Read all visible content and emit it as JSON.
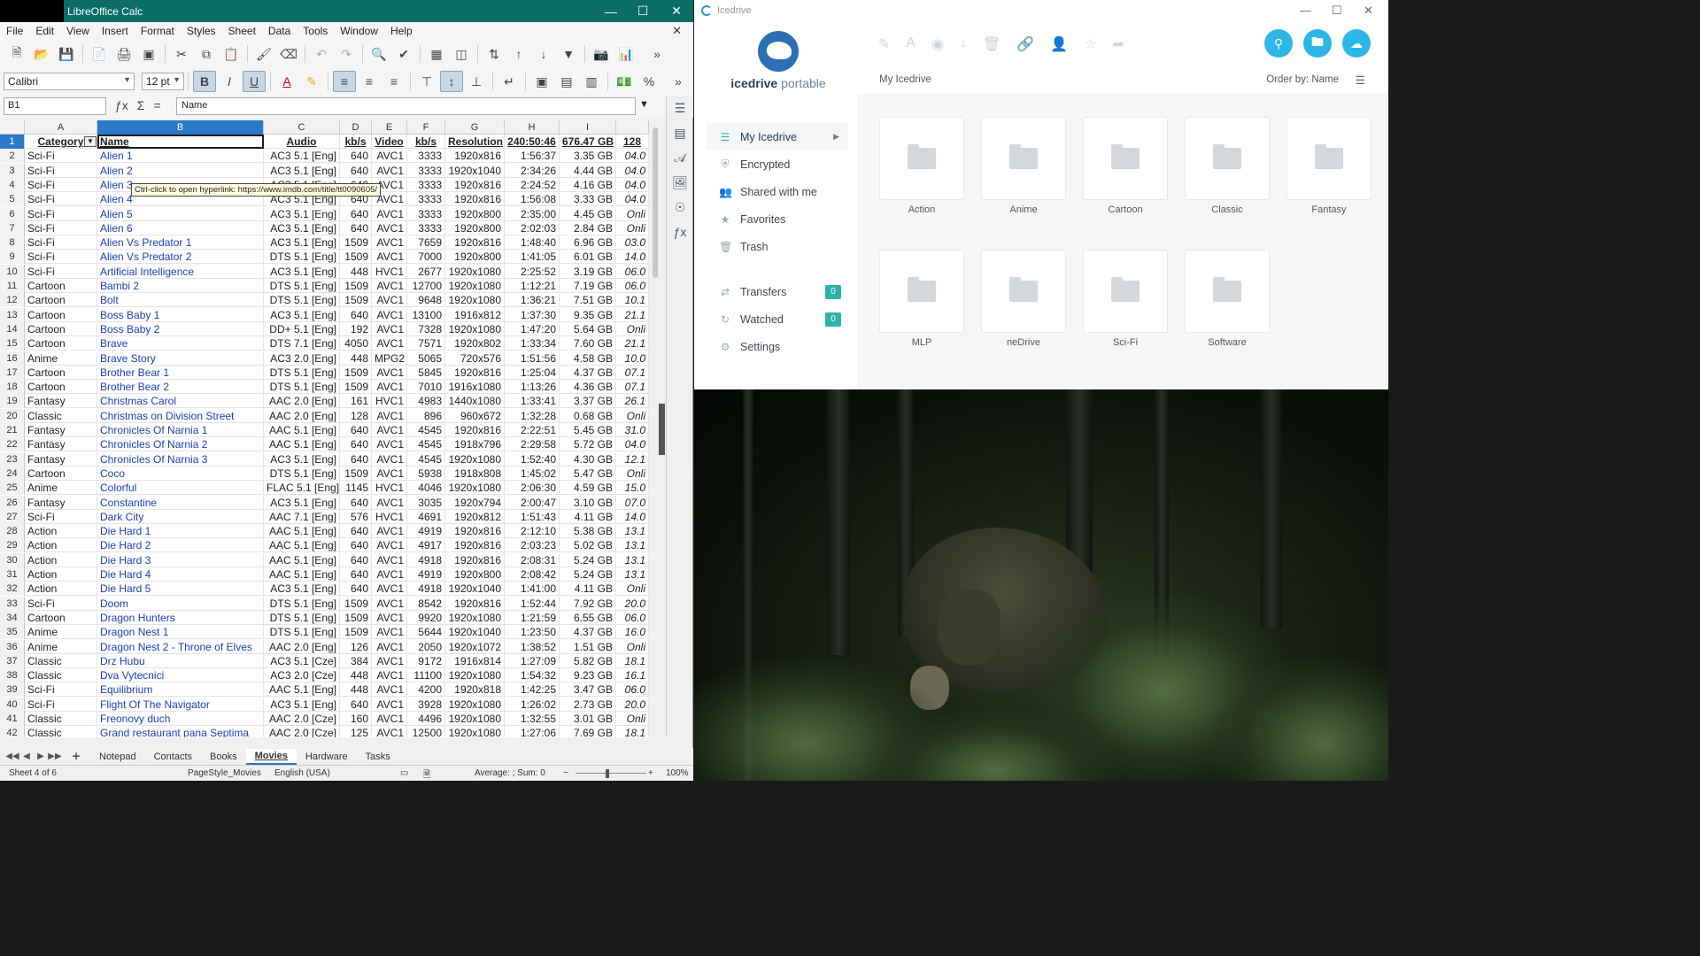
{
  "calc": {
    "title": "LibreOffice Calc",
    "menu": [
      "File",
      "Edit",
      "View",
      "Insert",
      "Format",
      "Styles",
      "Sheet",
      "Data",
      "Tools",
      "Window",
      "Help"
    ],
    "font_name": "Calibri",
    "font_size": "12 pt",
    "name_box": "B1",
    "formula": "Name",
    "columns": [
      "A",
      "B",
      "C",
      "D",
      "E",
      "F",
      "G",
      "H",
      "I"
    ],
    "header": [
      "Category",
      "Name",
      "Audio",
      "kb/s",
      "Video",
      "kb/s",
      "Resolution",
      "240:50:46",
      "676.47 GB",
      "128"
    ],
    "rows": [
      [
        "2",
        "Sci-Fi",
        "Alien 1",
        "AC3 5.1 [Eng]",
        "640",
        "AVC1",
        "3333",
        "1920x816",
        "1:56:37",
        "3.35 GB",
        "04.0"
      ],
      [
        "3",
        "Sci-Fi",
        "Alien 2",
        "AC3 5.1 [Eng]",
        "640",
        "AVC1",
        "3333",
        "1920x1040",
        "2:34:26",
        "4.44 GB",
        "04.0"
      ],
      [
        "4",
        "Sci-Fi",
        "Alien 3",
        "AC3 5.1 [Eng]",
        "640",
        "AVC1",
        "3333",
        "1920x816",
        "2:24:52",
        "4.16 GB",
        "04.0"
      ],
      [
        "5",
        "Sci-Fi",
        "Alien 4",
        "AC3 5.1 [Eng]",
        "640",
        "AVC1",
        "3333",
        "1920x816",
        "1:56:08",
        "3.33 GB",
        "04.0"
      ],
      [
        "6",
        "Sci-Fi",
        "Alien 5",
        "AC3 5.1 [Eng]",
        "640",
        "AVC1",
        "3333",
        "1920x800",
        "2:35:00",
        "4.45 GB",
        "Onli"
      ],
      [
        "7",
        "Sci-Fi",
        "Alien 6",
        "AC3 5.1 [Eng]",
        "640",
        "AVC1",
        "3333",
        "1920x800",
        "2:02:03",
        "2.84 GB",
        "Onli"
      ],
      [
        "8",
        "Sci-Fi",
        "Alien Vs Predator 1",
        "AC3 5.1 [Eng]",
        "1509",
        "AVC1",
        "7659",
        "1920x816",
        "1:48:40",
        "6.96 GB",
        "03.0"
      ],
      [
        "9",
        "Sci-Fi",
        "Alien Vs Predator 2",
        "DTS 5.1 [Eng]",
        "1509",
        "AVC1",
        "7000",
        "1920x800",
        "1:41:05",
        "6.01 GB",
        "14.0"
      ],
      [
        "10",
        "Sci-Fi",
        "Artificial Intelligence",
        "AC3 5.1 [Eng]",
        "448",
        "HVC1",
        "2677",
        "1920x1080",
        "2:25:52",
        "3.19 GB",
        "06.0"
      ],
      [
        "11",
        "Cartoon",
        "Bambi 2",
        "DTS 5.1 [Eng]",
        "1509",
        "AVC1",
        "12700",
        "1920x1080",
        "1:12:21",
        "7.19 GB",
        "06.0"
      ],
      [
        "12",
        "Cartoon",
        "Bolt",
        "DTS 5.1 [Eng]",
        "1509",
        "AVC1",
        "9648",
        "1920x1080",
        "1:36:21",
        "7.51 GB",
        "10.1"
      ],
      [
        "13",
        "Cartoon",
        "Boss Baby 1",
        "AC3 5.1 [Eng]",
        "640",
        "AVC1",
        "13100",
        "1916x812",
        "1:37:30",
        "9.35 GB",
        "21.1"
      ],
      [
        "14",
        "Cartoon",
        "Boss Baby 2",
        "DD+ 5.1 [Eng]",
        "192",
        "AVC1",
        "7328",
        "1920x1080",
        "1:47:20",
        "5.64 GB",
        "Onli"
      ],
      [
        "15",
        "Cartoon",
        "Brave",
        "DTS 7.1 [Eng]",
        "4050",
        "AVC1",
        "7571",
        "1920x802",
        "1:33:34",
        "7.60 GB",
        "21.1"
      ],
      [
        "16",
        "Anime",
        "Brave Story",
        "AC3 2.0 [Eng]",
        "448",
        "MPG2",
        "5065",
        "720x576",
        "1:51:56",
        "4.58 GB",
        "10.0"
      ],
      [
        "17",
        "Cartoon",
        "Brother Bear 1",
        "DTS 5.1 [Eng]",
        "1509",
        "AVC1",
        "5845",
        "1920x816",
        "1:25:04",
        "4.37 GB",
        "07.1"
      ],
      [
        "18",
        "Cartoon",
        "Brother Bear 2",
        "DTS 5.1 [Eng]",
        "1509",
        "AVC1",
        "7010",
        "1916x1080",
        "1:13:26",
        "4.36 GB",
        "07.1"
      ],
      [
        "19",
        "Fantasy",
        "Christmas Carol",
        "AAC 2.0 [Eng]",
        "161",
        "HVC1",
        "4983",
        "1440x1080",
        "1:33:41",
        "3.37 GB",
        "26.1"
      ],
      [
        "20",
        "Classic",
        "Christmas on Division Street",
        "AAC 2.0 [Eng]",
        "128",
        "AVC1",
        "896",
        "960x672",
        "1:32:28",
        "0.68 GB",
        "Onli"
      ],
      [
        "21",
        "Fantasy",
        "Chronicles Of Narnia 1",
        "AAC 5.1 [Eng]",
        "640",
        "AVC1",
        "4545",
        "1920x816",
        "2:22:51",
        "5.45 GB",
        "31.0"
      ],
      [
        "22",
        "Fantasy",
        "Chronicles Of Narnia 2",
        "AAC 5.1 [Eng]",
        "640",
        "AVC1",
        "4545",
        "1918x796",
        "2:29:58",
        "5.72 GB",
        "04.0"
      ],
      [
        "23",
        "Fantasy",
        "Chronicles Of Narnia 3",
        "AC3 5.1 [Eng]",
        "640",
        "AVC1",
        "4545",
        "1920x1080",
        "1:52:40",
        "4.30 GB",
        "12.1"
      ],
      [
        "24",
        "Cartoon",
        "Coco",
        "DTS 5.1 [Eng]",
        "1509",
        "AVC1",
        "5938",
        "1918x808",
        "1:45:02",
        "5.47 GB",
        "Onli"
      ],
      [
        "25",
        "Anime",
        "Colorful",
        "FLAC 5.1 [Eng]",
        "1145",
        "HVC1",
        "4046",
        "1920x1080",
        "2:06:30",
        "4.59 GB",
        "15.0"
      ],
      [
        "26",
        "Fantasy",
        "Constantine",
        "AC3 5.1 [Eng]",
        "640",
        "AVC1",
        "3035",
        "1920x794",
        "2:00:47",
        "3.10 GB",
        "07.0"
      ],
      [
        "27",
        "Sci-Fi",
        "Dark City",
        "AAC 7.1 [Eng]",
        "576",
        "HVC1",
        "4691",
        "1920x812",
        "1:51:43",
        "4.11 GB",
        "14.0"
      ],
      [
        "28",
        "Action",
        "Die Hard 1",
        "AAC 5.1 [Eng]",
        "640",
        "AVC1",
        "4919",
        "1920x816",
        "2:12:10",
        "5.38 GB",
        "13.1"
      ],
      [
        "29",
        "Action",
        "Die Hard 2",
        "AAC 5.1 [Eng]",
        "640",
        "AVC1",
        "4917",
        "1920x816",
        "2:03:23",
        "5.02 GB",
        "13.1"
      ],
      [
        "30",
        "Action",
        "Die Hard 3",
        "AAC 5.1 [Eng]",
        "640",
        "AVC1",
        "4918",
        "1920x816",
        "2:08:31",
        "5.24 GB",
        "13.1"
      ],
      [
        "31",
        "Action",
        "Die Hard 4",
        "AAC 5.1 [Eng]",
        "640",
        "AVC1",
        "4919",
        "1920x800",
        "2:08:42",
        "5.24 GB",
        "13.1"
      ],
      [
        "32",
        "Action",
        "Die Hard 5",
        "AC3 5.1 [Eng]",
        "640",
        "AVC1",
        "4918",
        "1920x1040",
        "1:41:00",
        "4.11 GB",
        "Onli"
      ],
      [
        "33",
        "Sci-Fi",
        "Doom",
        "DTS 5.1 [Eng]",
        "1509",
        "AVC1",
        "8542",
        "1920x816",
        "1:52:44",
        "7.92 GB",
        "20.0"
      ],
      [
        "34",
        "Cartoon",
        "Dragon Hunters",
        "DTS 5.1 [Eng]",
        "1509",
        "AVC1",
        "9920",
        "1920x1080",
        "1:21:59",
        "6.55 GB",
        "06.0"
      ],
      [
        "35",
        "Anime",
        "Dragon Nest 1",
        "DTS 5.1 [Eng]",
        "1509",
        "AVC1",
        "5644",
        "1920x1040",
        "1:23:50",
        "4.37 GB",
        "16.0"
      ],
      [
        "36",
        "Anime",
        "Dragon Nest 2 - Throne of Elves",
        "AAC 2.0 [Eng]",
        "126",
        "AVC1",
        "2050",
        "1920x1072",
        "1:38:52",
        "1.51 GB",
        "Onli"
      ],
      [
        "37",
        "Classic",
        "Drz Hubu",
        "AC3 5.1 [Cze]",
        "384",
        "AVC1",
        "9172",
        "1916x814",
        "1:27:09",
        "5.82 GB",
        "18.1"
      ],
      [
        "38",
        "Classic",
        "Dva Vytecnici",
        "AC3 2.0 [Cze]",
        "448",
        "AVC1",
        "11100",
        "1920x1080",
        "1:54:32",
        "9.23 GB",
        "16.1"
      ],
      [
        "39",
        "Sci-Fi",
        "Equilibrium",
        "AAC 5.1 [Eng]",
        "448",
        "AVC1",
        "4200",
        "1920x818",
        "1:42:25",
        "3.47 GB",
        "06.0"
      ],
      [
        "40",
        "Sci-Fi",
        "Flight Of The Navigator",
        "AC3 5.1 [Eng]",
        "640",
        "AVC1",
        "3928",
        "1920x1080",
        "1:26:02",
        "2.73 GB",
        "20.0"
      ],
      [
        "41",
        "Classic",
        "Freonovy duch",
        "AAC 2.0 [Cze]",
        "160",
        "AVC1",
        "4496",
        "1920x1080",
        "1:32:55",
        "3.01 GB",
        "Onli"
      ],
      [
        "42",
        "Classic",
        "Grand restaurant pana Septima",
        "AAC 2.0 [Cze]",
        "125",
        "AVC1",
        "12500",
        "1920x1080",
        "1:27:06",
        "7.69 GB",
        "18.1"
      ]
    ],
    "tooltip": "Ctrl-click to open hyperlink: https://www.imdb.com/title/tt0090605/",
    "sheet_tabs": [
      "Notepad",
      "Contacts",
      "Books",
      "Movies",
      "Hardware",
      "Tasks"
    ],
    "active_tab": "Movies",
    "status": {
      "sheet": "Sheet 4 of 6",
      "style": "PageStyle_Movies",
      "language": "English (USA)",
      "sum": "Average: ; Sum: 0",
      "zoom": "100%"
    }
  },
  "icedrive": {
    "title": "Icedrive",
    "brand": "icedrive",
    "brand_suffix": "portable",
    "breadcrumb": "My Icedrive",
    "order_by": "Order by: Name",
    "nav": [
      {
        "label": "My Icedrive",
        "icon": "layers-icon"
      },
      {
        "label": "Encrypted",
        "icon": "shield-icon"
      },
      {
        "label": "Shared with me",
        "icon": "users-icon"
      },
      {
        "label": "Favorites",
        "icon": "star-icon"
      },
      {
        "label": "Trash",
        "icon": "trash-icon"
      }
    ],
    "nav2": [
      {
        "label": "Transfers",
        "count": "0",
        "icon": "transfer-icon"
      },
      {
        "label": "Watched",
        "count": "0",
        "icon": "history-icon"
      },
      {
        "label": "Settings",
        "icon": "gear-icon"
      }
    ],
    "folders": [
      "Action",
      "Anime",
      "Cartoon",
      "Classic",
      "Fantasy",
      "MLP",
      "neDrive",
      "Sci-Fi",
      "Software"
    ],
    "accent": "#2db7e8",
    "count_color": "#2db3a8"
  }
}
